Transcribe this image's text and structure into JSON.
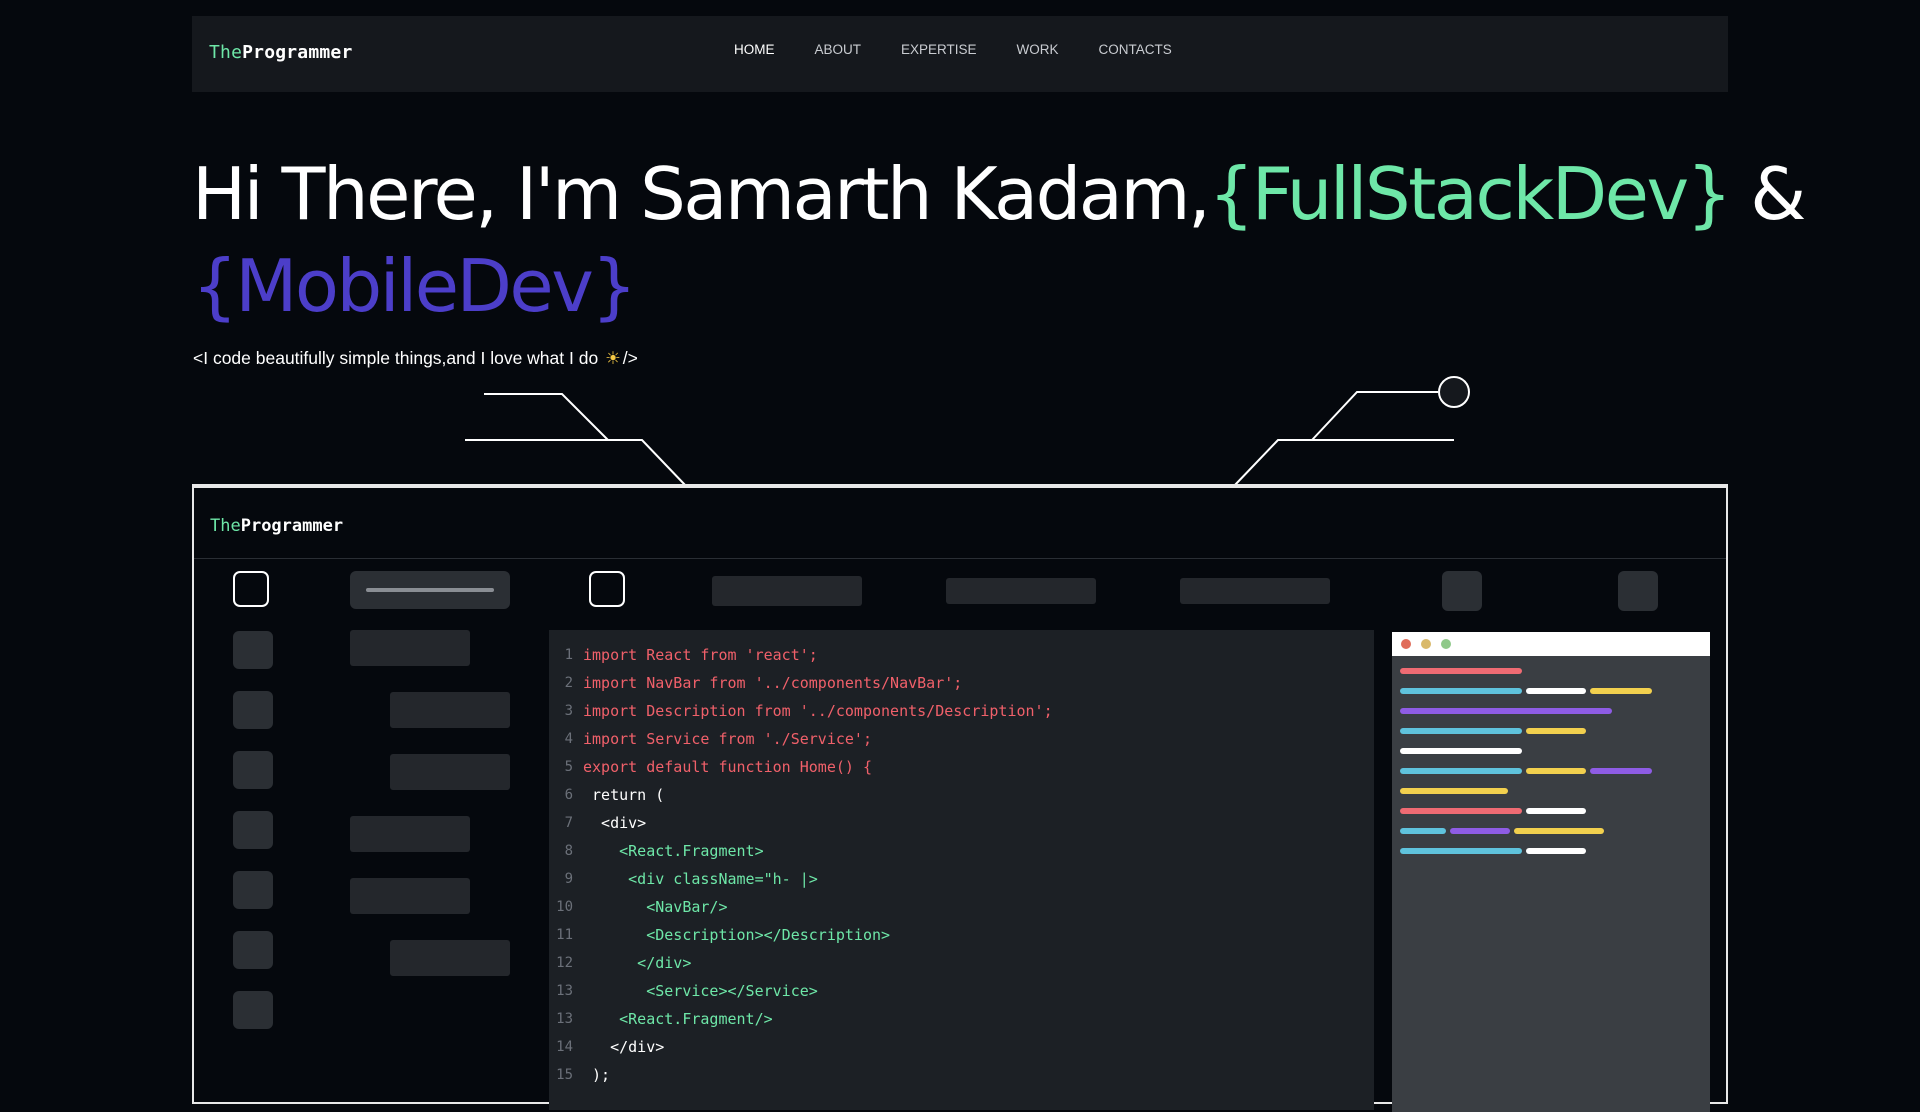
{
  "navbar": {
    "logo_part1": "The",
    "logo_part2": "Programmer",
    "links": [
      "HOME",
      "ABOUT",
      "EXPERTISE",
      "WORK",
      "CONTACTS"
    ]
  },
  "hero": {
    "line1_prefix": "Hi There, I'm Samarth Kadam,",
    "highlight1": "{FullStackDev}",
    "connector": " &",
    "highlight2": "{MobileDev}",
    "tagline_start": "<I code beautifully simple things,and I love what I do",
    "tagline_emoji": "☀",
    "tagline_end": "/>"
  },
  "mock": {
    "logo_part1": "The",
    "logo_part2": "Programmer",
    "code_lines": [
      {
        "n": "1",
        "text": "import React from 'react';",
        "color": "red"
      },
      {
        "n": "2",
        "text": "import NavBar from '../components/NavBar';",
        "color": "red"
      },
      {
        "n": "3",
        "text": "import Description from '../components/Description';",
        "color": "red"
      },
      {
        "n": "4",
        "text": "import Service from './Service';",
        "color": "red"
      },
      {
        "n": "5",
        "text": "export default function Home() {",
        "color": "red"
      },
      {
        "n": "6",
        "text": " return (",
        "color": "white"
      },
      {
        "n": "7",
        "text": "  <div>",
        "color": "white"
      },
      {
        "n": "8",
        "text": "    <React.Fragment>",
        "color": "green"
      },
      {
        "n": "9",
        "text": "     <div className=\"h- |>",
        "color": "green"
      },
      {
        "n": "10",
        "text": "       <NavBar/>",
        "color": "green"
      },
      {
        "n": "11",
        "text": "       <Description></Description>",
        "color": "green"
      },
      {
        "n": "12",
        "text": "      </div>",
        "color": "green"
      },
      {
        "n": "13",
        "text": "       <Service></Service>",
        "color": "green"
      },
      {
        "n": "13",
        "text": "    <React.Fragment/>",
        "color": "green"
      },
      {
        "n": "14",
        "text": "   </div>",
        "color": "white"
      },
      {
        "n": "15",
        "text": " );",
        "color": "white"
      }
    ]
  },
  "colors": {
    "background": "#05080d",
    "accent_green": "#6ee7a8",
    "accent_purple": "#4c3ec9",
    "code_red": "#f0606a",
    "preview_red": "#ef6b73",
    "preview_blue": "#5fc3dd",
    "preview_yellow": "#f2d04e",
    "preview_purple": "#8e5ce5"
  }
}
